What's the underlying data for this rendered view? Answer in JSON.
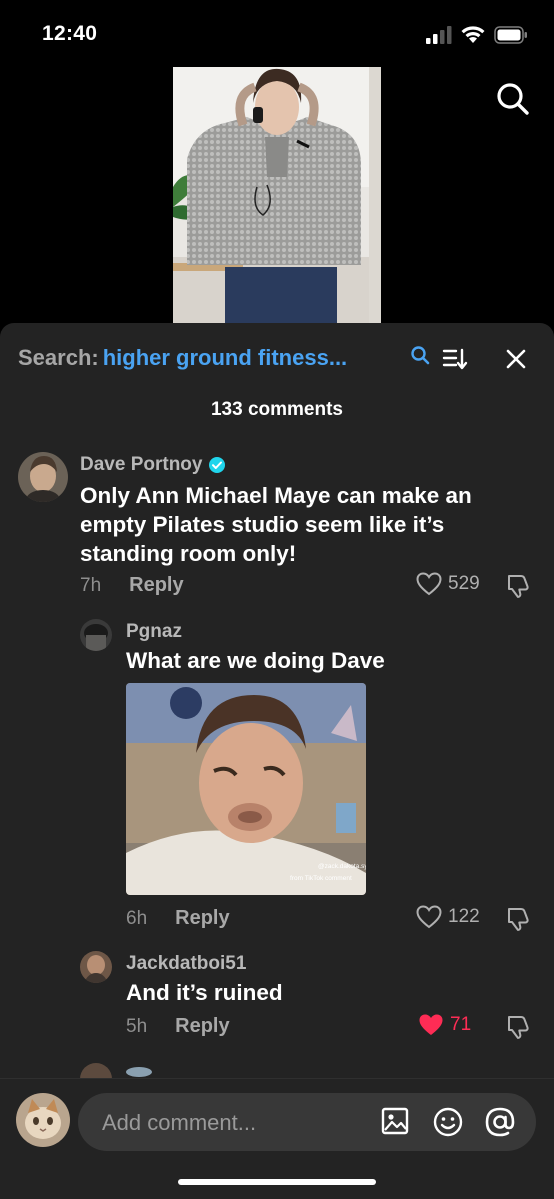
{
  "status": {
    "time": "12:40"
  },
  "icons": {
    "signal": "cellular-signal-icon",
    "wifi": "wifi-icon",
    "battery": "battery-icon",
    "search": "search-icon",
    "sort": "sort-icon",
    "close": "close-icon",
    "verified": "verified-badge-icon",
    "heart": "heart-icon",
    "dislike": "thumbs-down-icon",
    "image": "image-icon",
    "emoji": "emoji-icon",
    "mention": "at-mention-icon"
  },
  "colors": {
    "search_query": "#4aa3f2",
    "liked_heart": "#fe2c55",
    "verified": "#20d5ec",
    "sheet_bg": "#232323"
  },
  "header": {
    "search_label": "Search:",
    "search_query": "higher ground fitness...",
    "comment_count": "133 comments"
  },
  "comments": [
    {
      "username": "Dave Portnoy",
      "verified": true,
      "text": "Only Ann Michael Maye can make an empty Pilates studio seem like it’s standing room only!",
      "age": "7h",
      "reply_label": "Reply",
      "likes": "529",
      "liked": false
    },
    {
      "username": "Pgnaz",
      "text": "What are we doing Dave",
      "image_caption": "@zack.dakota.sy / from TikTok comment",
      "age": "6h",
      "reply_label": "Reply",
      "likes": "122",
      "liked": false
    },
    {
      "username": "Jackdatboi51",
      "text": "And it’s ruined",
      "age": "5h",
      "reply_label": "Reply",
      "likes": "71",
      "liked": true
    }
  ],
  "composer": {
    "placeholder": "Add comment..."
  }
}
